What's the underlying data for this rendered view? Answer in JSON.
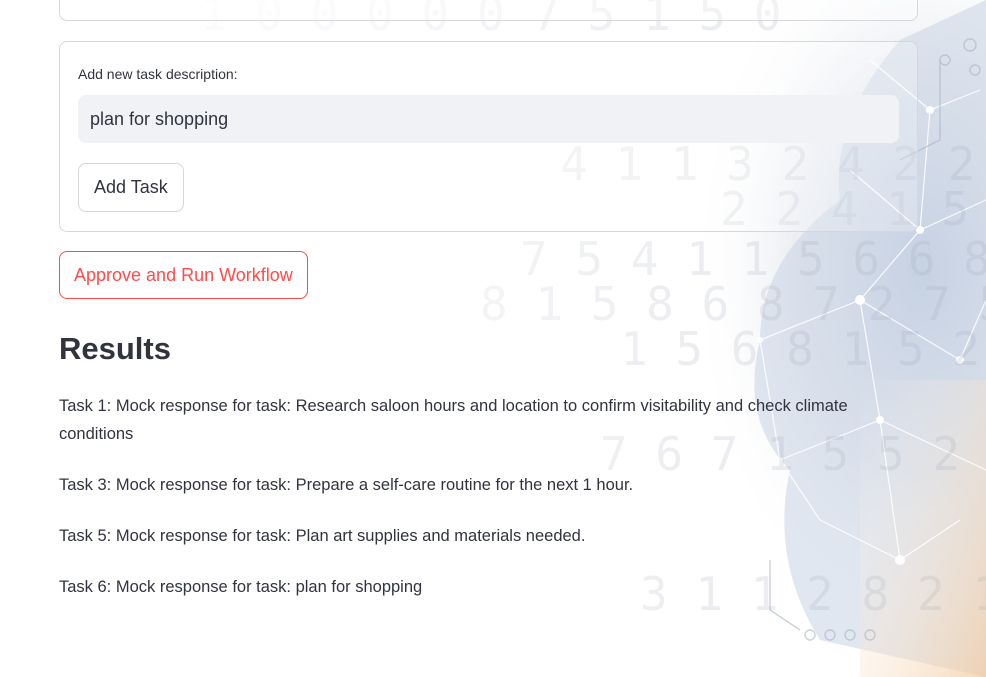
{
  "task_form": {
    "label": "Add new task description:",
    "input_value": "plan for shopping",
    "add_button_label": "Add Task"
  },
  "run_button_label": "Approve and Run Workflow",
  "results": {
    "heading": "Results",
    "items": [
      "Task 1: Mock response for task: Research saloon hours and location to confirm visitability and check climate conditions",
      "Task 3: Mock response for task: Prepare a self-care routine for the next 1 hour.",
      "Task 5: Mock response for task: Plan art supplies and materials needed.",
      "Task 6: Mock response for task: plan for shopping"
    ]
  },
  "colors": {
    "accent": "#ff4b4b",
    "text": "#31333f",
    "input_bg": "#f0f2f6",
    "border": "#d6d7db"
  }
}
